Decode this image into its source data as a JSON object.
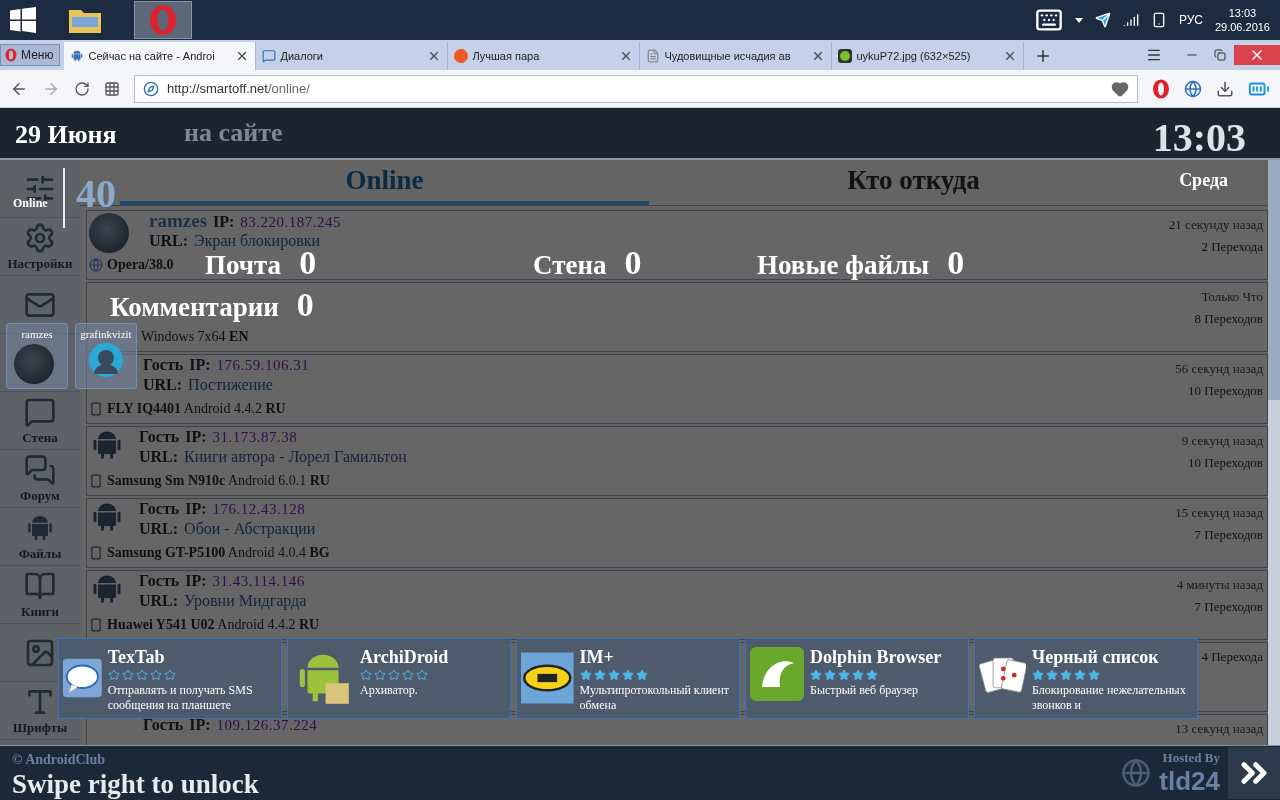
{
  "taskbar": {
    "apps": [
      {
        "kind": "folder",
        "selected": false
      },
      {
        "kind": "opera",
        "selected": true
      }
    ],
    "language": "РУС",
    "time": "13:03",
    "date": "29.06.2016"
  },
  "browser": {
    "menu_label": "Меню",
    "tabs": [
      {
        "title": "Сейчас на сайте - Androi",
        "kind": "android",
        "selected": true
      },
      {
        "title": "Диалоги",
        "kind": "chat",
        "selected": false
      },
      {
        "title": "Лучшая пара",
        "kind": "orange",
        "selected": false
      },
      {
        "title": "Чудовищные исчадия ав",
        "kind": "page",
        "selected": false
      },
      {
        "title": "uykuP72.jpg (632×525)",
        "kind": "image",
        "selected": false
      }
    ],
    "address": {
      "host": "http://smartoff.net",
      "path": "/online/"
    }
  },
  "page": {
    "header_title": "на сайте",
    "sidebar": [
      {
        "kind": "sliders"
      },
      {
        "label": "Настройки",
        "kind": "gear"
      },
      {
        "kind": "mail"
      },
      {
        "kind": "covered"
      },
      {
        "label": "Стена",
        "kind": "wall"
      },
      {
        "label": "Форум",
        "kind": "forum"
      },
      {
        "label": "Файлы",
        "kind": "android"
      },
      {
        "label": "Книги",
        "kind": "book"
      },
      {
        "kind": "image"
      },
      {
        "label": "Шрифты",
        "kind": "font"
      }
    ],
    "tabs": [
      {
        "label": "Online",
        "selected": true
      },
      {
        "label": "Кто откуда",
        "selected": false
      }
    ],
    "visitors": [
      {
        "kind": "user",
        "name": "ramzes",
        "ip_label": "IP:",
        "ip": "83.220.187.245",
        "url_label": "URL:",
        "url": "Экран блокировки",
        "device": "**Opera/38.0**",
        "time": "21 секунду назад",
        "transitions": "2 Перехода"
      },
      {
        "kind": "partial",
        "device": "Windows 7x64 **EN**",
        "time": "Только Что",
        "transitions": "8 Переходов"
      },
      {
        "kind": "guest_covered",
        "name": "Гость",
        "ip_label": "IP:",
        "ip": "176.59.106.31",
        "url_label": "URL:",
        "url": "Постижение",
        "device": "**FLY IQ4401** Android 4.4.2 **RU**",
        "time": "56 секунд назад",
        "transitions": "10 Переходов"
      },
      {
        "kind": "guest",
        "name": "Гость",
        "ip_label": "IP:",
        "ip": "31.173.87.38",
        "url_label": "URL:",
        "url": "Книги автора - Лорел Гамильтон",
        "device": "**Samsung Sm N910c** Android 6.0.1 **RU**",
        "time": "9 секунд назад",
        "transitions": "10 Переходов"
      },
      {
        "kind": "guest",
        "name": "Гость",
        "ip_label": "IP:",
        "ip": "176.12.43.128",
        "url_label": "URL:",
        "url": "Обои - Абстракции",
        "device": "**Samsung GT-P5100** Android 4.0.4 **BG**",
        "time": "15 секунд назад",
        "transitions": "7 Переходов"
      },
      {
        "kind": "guest",
        "name": "Гость",
        "ip_label": "IP:",
        "ip": "31.43.114.146",
        "url_label": "URL:",
        "url": "Уровни Мидгарда",
        "device": "**Huawei Y541 U02** Android 4.4.2 **RU**",
        "time": "4 минуты назад",
        "transitions": "7 Переходов"
      },
      {
        "kind": "hidden",
        "transitions": "4 Перехода"
      },
      {
        "kind": "hidden",
        "name": "Гость",
        "ip_label": "IP:",
        "ip": "109.126.37.224",
        "time": "13 секунд назад"
      }
    ]
  },
  "lockscreen": {
    "date": "29 Июня",
    "time": "13:03",
    "weekday": "Среда",
    "online_label": "Online",
    "online_count": "40",
    "counters": [
      {
        "label": "Почта",
        "value": "0"
      },
      {
        "label": "Стена",
        "value": "0"
      },
      {
        "label": "Новые файлы",
        "value": "0"
      },
      {
        "label": "Комментарии",
        "value": "0"
      }
    ],
    "users": [
      {
        "name": "ramzes",
        "kind": "photo"
      },
      {
        "name": "grafinkvizit",
        "kind": "android"
      }
    ],
    "apps": [
      {
        "title": "TexTab",
        "kind": "sms",
        "stars": 0,
        "description": "Отправлять и получать SMS сообщения на планшете"
      },
      {
        "title": "ArchiDroid",
        "kind": "android",
        "stars": 0,
        "description": "Архиватор."
      },
      {
        "title": "IM+",
        "kind": "implus",
        "stars": 5,
        "description": "Мультипротокольный клиент обмена"
      },
      {
        "title": "Dolphin Browser",
        "kind": "dolphin",
        "stars": 5,
        "description": "Быстрый веб браузер"
      },
      {
        "title": "Черный список",
        "kind": "cards",
        "stars": 5,
        "description": "Блокирование нежелательных звонков и"
      }
    ],
    "footer": {
      "copyright": "© AndroidClub",
      "swipe": "Swipe right to unlock",
      "hosted_by": "Hosted By",
      "host": "tld24"
    }
  }
}
